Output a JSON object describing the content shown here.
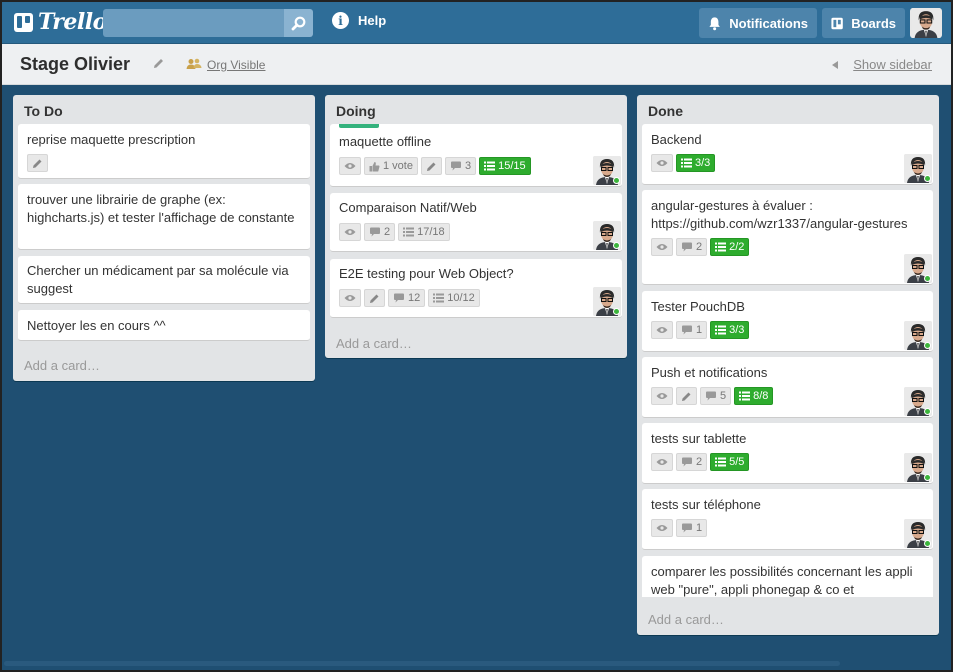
{
  "header": {
    "logo_text": "Trello",
    "search_placeholder": "",
    "help_label": "Help",
    "notifications_label": "Notifications",
    "boards_label": "Boards"
  },
  "board": {
    "title": "Stage Olivier",
    "visibility": "Org Visible",
    "sidebar_toggle": "Show sidebar"
  },
  "colors": {
    "header": "#2e6d98",
    "board_bg": "#1f4f72",
    "badge_green": "#2eac2e",
    "label_green": "#34b27d"
  },
  "lists": [
    {
      "title": "To Do",
      "add_card": "Add a card…",
      "cards": [
        {
          "text": "reprise maquette prescription",
          "badges": [
            {
              "icon": "pencil-icon"
            }
          ]
        },
        {
          "text": "trouver une librairie de graphe (ex: highcharts.js) et tester l'affichage de constante",
          "badges": []
        },
        {
          "text": "Chercher un médicament par sa molécule via suggest",
          "badges": []
        },
        {
          "text": "Nettoyer les en cours ^^",
          "badges": []
        }
      ]
    },
    {
      "title": "Doing",
      "add_card": "Add a card…",
      "cards": [
        {
          "text": "maquette offline",
          "label_color": "#34b27d",
          "badges": [
            {
              "icon": "eye-icon"
            },
            {
              "icon": "thumbs-up-icon",
              "text": "1 vote"
            },
            {
              "icon": "pencil-icon"
            },
            {
              "icon": "comment-icon",
              "text": "3"
            },
            {
              "icon": "checklist-icon",
              "text": "15/15",
              "complete": true
            }
          ]
        },
        {
          "text": "Comparaison Natif/Web",
          "badges": [
            {
              "icon": "eye-icon"
            },
            {
              "icon": "comment-icon",
              "text": "2"
            },
            {
              "icon": "checklist-icon",
              "text": "17/18"
            }
          ]
        },
        {
          "text": "E2E testing pour Web Object?",
          "badges": [
            {
              "icon": "eye-icon"
            },
            {
              "icon": "pencil-icon"
            },
            {
              "icon": "comment-icon",
              "text": "12"
            },
            {
              "icon": "checklist-icon",
              "text": "10/12"
            }
          ]
        }
      ]
    },
    {
      "title": "Done",
      "add_card": "Add a card…",
      "cards": [
        {
          "text": "Backend",
          "badges": [
            {
              "icon": "eye-icon"
            },
            {
              "icon": "checklist-icon",
              "text": "3/3",
              "complete": true
            }
          ]
        },
        {
          "text": "angular-gestures à évaluer : https://github.com/wzr1337/angular-gestures",
          "badges": [
            {
              "icon": "eye-icon"
            },
            {
              "icon": "comment-icon",
              "text": "2"
            },
            {
              "icon": "checklist-icon",
              "text": "2/2",
              "complete": true
            }
          ]
        },
        {
          "text": "Tester PouchDB",
          "badges": [
            {
              "icon": "eye-icon"
            },
            {
              "icon": "comment-icon",
              "text": "1"
            },
            {
              "icon": "checklist-icon",
              "text": "3/3",
              "complete": true
            }
          ]
        },
        {
          "text": "Push et notifications",
          "badges": [
            {
              "icon": "eye-icon"
            },
            {
              "icon": "pencil-icon"
            },
            {
              "icon": "comment-icon",
              "text": "5"
            },
            {
              "icon": "checklist-icon",
              "text": "8/8",
              "complete": true
            }
          ]
        },
        {
          "text": "tests sur tablette",
          "badges": [
            {
              "icon": "eye-icon"
            },
            {
              "icon": "comment-icon",
              "text": "2"
            },
            {
              "icon": "checklist-icon",
              "text": "5/5",
              "complete": true
            }
          ]
        },
        {
          "text": "tests sur téléphone",
          "badges": [
            {
              "icon": "eye-icon"
            },
            {
              "icon": "comment-icon",
              "text": "1"
            }
          ]
        },
        {
          "text": "comparer les possibilités concernant les appli web \"pure\", appli phonegap & co et",
          "badges": []
        }
      ]
    }
  ]
}
